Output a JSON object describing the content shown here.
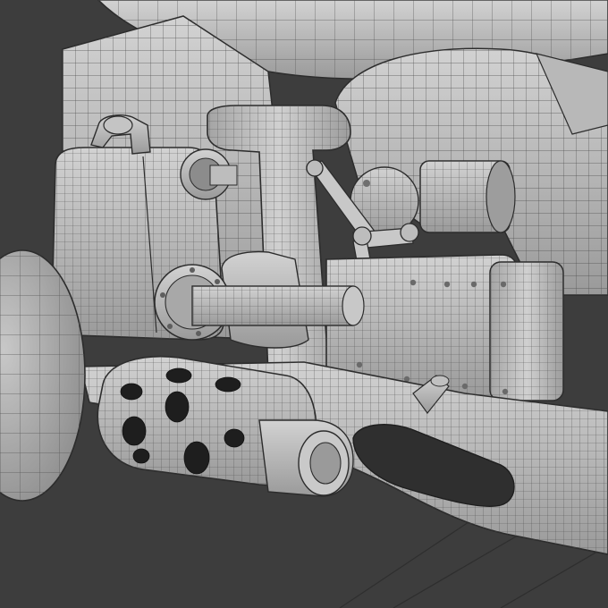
{
  "viewport": {
    "background_color": "#3d3d3d",
    "mesh_color": "#bdbdbd",
    "wire_color": "#4a4a4a",
    "shadow_color": "#8a8a8a",
    "highlight_color": "#e6e6e6",
    "hole_color": "#1e1e1e"
  }
}
